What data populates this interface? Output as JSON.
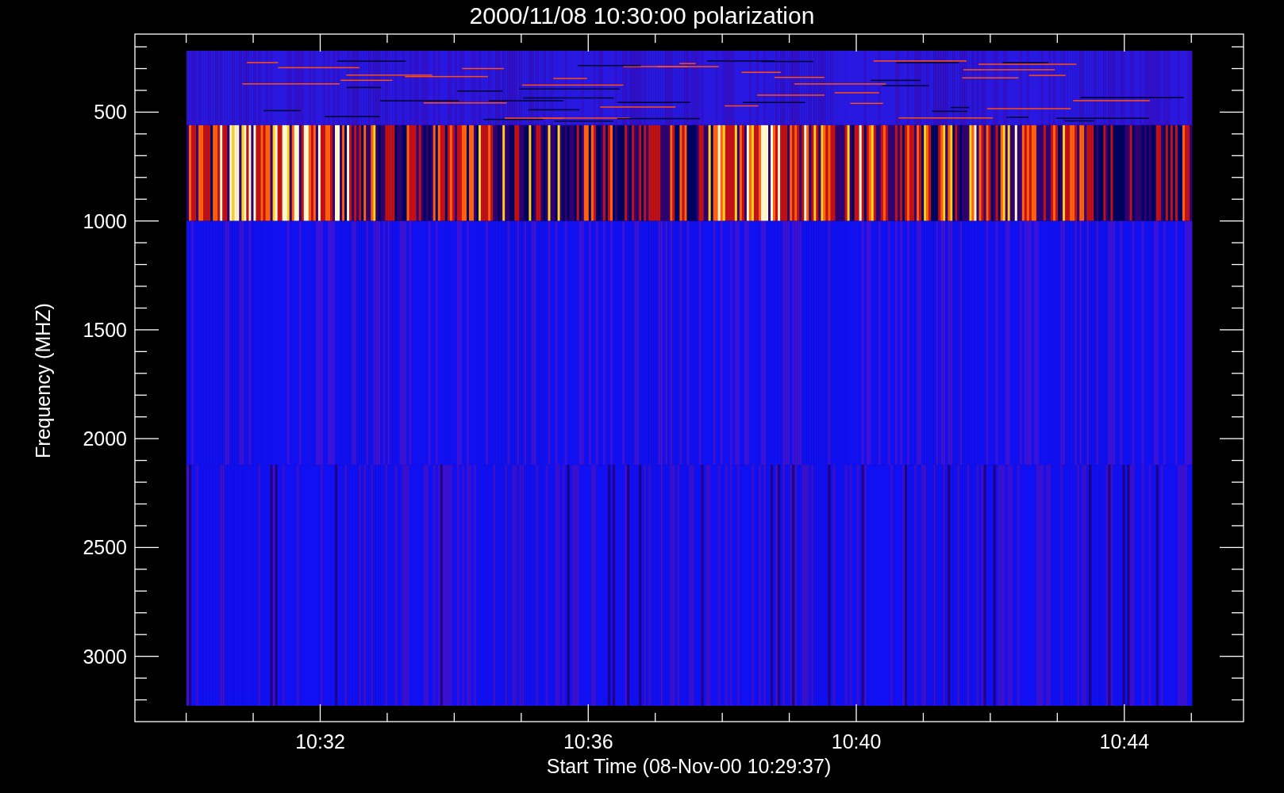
{
  "title": "2000/11/08 10:30:00 polarization",
  "x_axis": {
    "label": "Start Time (08-Nov-00 10:29:37)",
    "ticks": [
      "10:32",
      "10:36",
      "10:40",
      "10:44"
    ]
  },
  "y_axis": {
    "label": "Frequency (MHZ)",
    "ticks": [
      "500",
      "1000",
      "1500",
      "2000",
      "2500",
      "3000"
    ]
  }
}
